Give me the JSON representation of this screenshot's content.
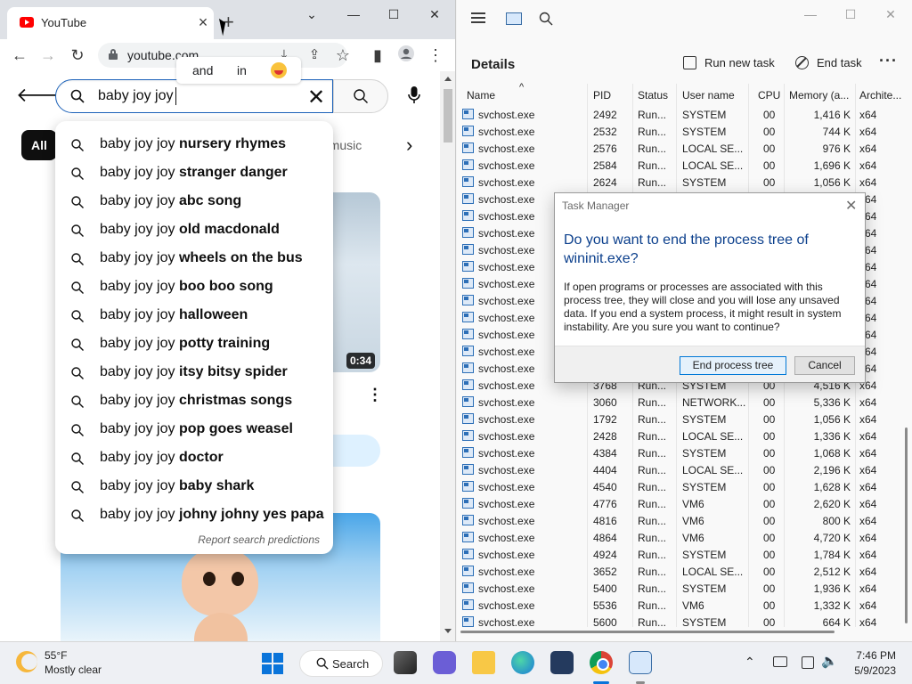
{
  "chrome": {
    "tab_title": "YouTube",
    "url": "youtube.com",
    "word_chips": [
      "and",
      "in"
    ],
    "search": {
      "value": "baby joy joy"
    },
    "chips": {
      "all": "All",
      "music": "d music"
    },
    "video_duration": "0:34",
    "suggestions": [
      {
        "prefix": "baby joy joy ",
        "bold": "nursery rhymes"
      },
      {
        "prefix": "baby joy joy ",
        "bold": "stranger danger"
      },
      {
        "prefix": "baby joy joy ",
        "bold": "abc song"
      },
      {
        "prefix": "baby joy joy ",
        "bold": "old macdonald"
      },
      {
        "prefix": "baby joy joy ",
        "bold": "wheels on the bus"
      },
      {
        "prefix": "baby joy joy ",
        "bold": "boo boo song"
      },
      {
        "prefix": "baby joy joy ",
        "bold": "halloween"
      },
      {
        "prefix": "baby joy joy ",
        "bold": "potty training"
      },
      {
        "prefix": "baby joy joy ",
        "bold": "itsy bitsy spider"
      },
      {
        "prefix": "baby joy joy ",
        "bold": "christmas songs"
      },
      {
        "prefix": "baby joy joy ",
        "bold": "pop goes weasel"
      },
      {
        "prefix": "baby joy joy ",
        "bold": "doctor"
      },
      {
        "prefix": "baby joy joy ",
        "bold": "baby shark"
      },
      {
        "prefix": "baby joy joy ",
        "bold": "johny johny yes papa"
      }
    ],
    "report_link": "Report search predictions"
  },
  "task_manager": {
    "page_title": "Details",
    "run_new_task": "Run new task",
    "end_task": "End task",
    "columns": [
      "Name",
      "PID",
      "Status",
      "User name",
      "CPU",
      "Memory (a...",
      "Archite..."
    ],
    "rows": [
      {
        "name": "svchost.exe",
        "pid": "2492",
        "status": "Run...",
        "user": "SYSTEM",
        "cpu": "00",
        "mem": "1,416 K",
        "arch": "x64"
      },
      {
        "name": "svchost.exe",
        "pid": "2532",
        "status": "Run...",
        "user": "SYSTEM",
        "cpu": "00",
        "mem": "744 K",
        "arch": "x64"
      },
      {
        "name": "svchost.exe",
        "pid": "2576",
        "status": "Run...",
        "user": "LOCAL SE...",
        "cpu": "00",
        "mem": "976 K",
        "arch": "x64"
      },
      {
        "name": "svchost.exe",
        "pid": "2584",
        "status": "Run...",
        "user": "LOCAL SE...",
        "cpu": "00",
        "mem": "1,696 K",
        "arch": "x64"
      },
      {
        "name": "svchost.exe",
        "pid": "2624",
        "status": "Run...",
        "user": "SYSTEM",
        "cpu": "00",
        "mem": "1,056 K",
        "arch": "x64"
      },
      {
        "name": "svchost.exe",
        "pid": "",
        "status": "",
        "user": "",
        "cpu": "",
        "mem": "",
        "arch": "x64"
      },
      {
        "name": "svchost.exe",
        "pid": "",
        "status": "",
        "user": "",
        "cpu": "",
        "mem": "",
        "arch": "x64"
      },
      {
        "name": "svchost.exe",
        "pid": "",
        "status": "",
        "user": "",
        "cpu": "",
        "mem": "",
        "arch": "x64"
      },
      {
        "name": "svchost.exe",
        "pid": "",
        "status": "",
        "user": "",
        "cpu": "",
        "mem": "",
        "arch": "x64"
      },
      {
        "name": "svchost.exe",
        "pid": "",
        "status": "",
        "user": "",
        "cpu": "",
        "mem": "",
        "arch": "x64"
      },
      {
        "name": "svchost.exe",
        "pid": "",
        "status": "",
        "user": "",
        "cpu": "",
        "mem": "",
        "arch": "x64"
      },
      {
        "name": "svchost.exe",
        "pid": "",
        "status": "",
        "user": "",
        "cpu": "",
        "mem": "",
        "arch": "x64"
      },
      {
        "name": "svchost.exe",
        "pid": "",
        "status": "",
        "user": "",
        "cpu": "",
        "mem": "",
        "arch": "x64"
      },
      {
        "name": "svchost.exe",
        "pid": "",
        "status": "",
        "user": "",
        "cpu": "",
        "mem": "",
        "arch": "x64"
      },
      {
        "name": "svchost.exe",
        "pid": "",
        "status": "",
        "user": "",
        "cpu": "",
        "mem": "",
        "arch": "x64"
      },
      {
        "name": "svchost.exe",
        "pid": "",
        "status": "",
        "user": "",
        "cpu": "",
        "mem": "",
        "arch": "x64"
      },
      {
        "name": "svchost.exe",
        "pid": "3768",
        "status": "Run...",
        "user": "SYSTEM",
        "cpu": "00",
        "mem": "4,516 K",
        "arch": "x64"
      },
      {
        "name": "svchost.exe",
        "pid": "3060",
        "status": "Run...",
        "user": "NETWORK...",
        "cpu": "00",
        "mem": "5,336 K",
        "arch": "x64"
      },
      {
        "name": "svchost.exe",
        "pid": "1792",
        "status": "Run...",
        "user": "SYSTEM",
        "cpu": "00",
        "mem": "1,056 K",
        "arch": "x64"
      },
      {
        "name": "svchost.exe",
        "pid": "2428",
        "status": "Run...",
        "user": "LOCAL SE...",
        "cpu": "00",
        "mem": "1,336 K",
        "arch": "x64"
      },
      {
        "name": "svchost.exe",
        "pid": "4384",
        "status": "Run...",
        "user": "SYSTEM",
        "cpu": "00",
        "mem": "1,068 K",
        "arch": "x64"
      },
      {
        "name": "svchost.exe",
        "pid": "4404",
        "status": "Run...",
        "user": "LOCAL SE...",
        "cpu": "00",
        "mem": "2,196 K",
        "arch": "x64"
      },
      {
        "name": "svchost.exe",
        "pid": "4540",
        "status": "Run...",
        "user": "SYSTEM",
        "cpu": "00",
        "mem": "1,628 K",
        "arch": "x64"
      },
      {
        "name": "svchost.exe",
        "pid": "4776",
        "status": "Run...",
        "user": "VM6",
        "cpu": "00",
        "mem": "2,620 K",
        "arch": "x64"
      },
      {
        "name": "svchost.exe",
        "pid": "4816",
        "status": "Run...",
        "user": "VM6",
        "cpu": "00",
        "mem": "800 K",
        "arch": "x64"
      },
      {
        "name": "svchost.exe",
        "pid": "4864",
        "status": "Run...",
        "user": "VM6",
        "cpu": "00",
        "mem": "4,720 K",
        "arch": "x64"
      },
      {
        "name": "svchost.exe",
        "pid": "4924",
        "status": "Run...",
        "user": "SYSTEM",
        "cpu": "00",
        "mem": "1,784 K",
        "arch": "x64"
      },
      {
        "name": "svchost.exe",
        "pid": "3652",
        "status": "Run...",
        "user": "LOCAL SE...",
        "cpu": "00",
        "mem": "2,512 K",
        "arch": "x64"
      },
      {
        "name": "svchost.exe",
        "pid": "5400",
        "status": "Run...",
        "user": "SYSTEM",
        "cpu": "00",
        "mem": "1,936 K",
        "arch": "x64"
      },
      {
        "name": "svchost.exe",
        "pid": "5536",
        "status": "Run...",
        "user": "VM6",
        "cpu": "00",
        "mem": "1,332 K",
        "arch": "x64"
      },
      {
        "name": "svchost.exe",
        "pid": "5600",
        "status": "Run...",
        "user": "SYSTEM",
        "cpu": "00",
        "mem": "664 K",
        "arch": "x64"
      }
    ]
  },
  "dialog": {
    "title": "Task Manager",
    "question": "Do you want to end the process tree of wininit.exe?",
    "body": "If open programs or processes are associated with this process tree, they will close and you will lose any unsaved data. If you end a system process, it might result in system instability. Are you sure you want to continue?",
    "primary_button": "End process tree",
    "cancel_button": "Cancel"
  },
  "taskbar": {
    "temperature": "55°F",
    "weather": "Mostly clear",
    "search_label": "Search",
    "time": "7:46 PM",
    "date": "5/9/2023"
  }
}
